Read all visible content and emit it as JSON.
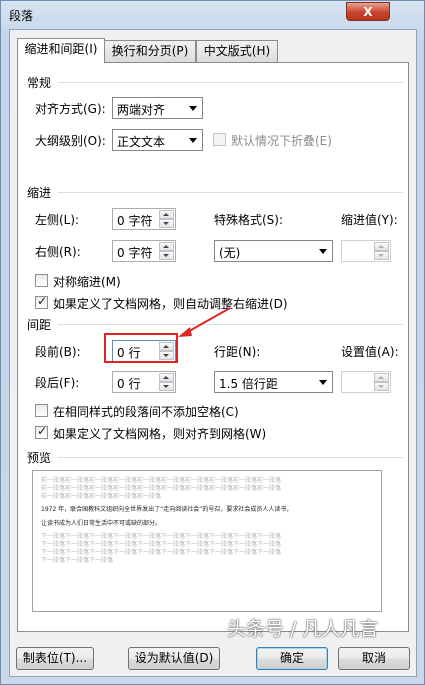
{
  "window": {
    "title": "段落",
    "close_glyph": "X"
  },
  "tabs": [
    {
      "label": "缩进和间距(I)",
      "active": true
    },
    {
      "label": "换行和分页(P)",
      "active": false
    },
    {
      "label": "中文版式(H)",
      "active": false
    }
  ],
  "general": {
    "heading": "常规",
    "alignment_label": "对齐方式(G):",
    "alignment_value": "两端对齐",
    "outline_label": "大纲级别(O):",
    "outline_value": "正文文本",
    "collapse_label": "默认情况下折叠(E)",
    "collapse_checked": false,
    "collapse_enabled": false
  },
  "indent": {
    "heading": "缩进",
    "left_label": "左侧(L):",
    "left_value": "0 字符",
    "right_label": "右侧(R):",
    "right_value": "0 字符",
    "special_label": "特殊格式(S):",
    "special_value": "(无)",
    "indent_by_label": "缩进值(Y):",
    "indent_by_value": "",
    "mirror_label": "对称缩进(M)",
    "mirror_checked": false,
    "auto_adjust_label": "如果定义了文档网格，则自动调整右缩进(D)",
    "auto_adjust_checked": true
  },
  "spacing": {
    "heading": "间距",
    "before_label": "段前(B):",
    "before_value": "0 行",
    "after_label": "段后(F):",
    "after_value": "0 行",
    "line_label": "行距(N):",
    "line_value": "1.5 倍行距",
    "at_label": "设置值(A):",
    "at_value": "",
    "no_space_label": "在相同样式的段落间不添加空格(C)",
    "no_space_checked": false,
    "snap_grid_label": "如果定义了文档网格，则对齐到网格(W)",
    "snap_grid_checked": true
  },
  "preview": {
    "heading": "预览",
    "prev_lines": [
      "前一段落前一段落前一段落前一段落前一段落前一段落前一段落前一段落前一段落前一段落",
      "前一段落前一段落前一段落前一段落前一段落前一段落前一段落前一段落前一段落前一段落",
      "前一段落前一段落前一段落前一段落前一段落"
    ],
    "sample_lines": [
      "1972 年，联合国教科文组织向全世界发出了“走向阅读社会”的号召，要求社会成员人人读书，",
      "让读书成为人们日常生活中不可或缺的部分。"
    ],
    "next_lines": [
      "下一段落下一段落下一段落下一段落下一段落下一段落下一段落下一段落下一段落下一段落",
      "下一段落下一段落下一段落下一段落下一段落下一段落下一段落下一段落下一段落下一段落",
      "下一段落下一段落下一段落下一段落下一段落下一段落下一段落下一段落下一段落下一段落",
      "下一段落下一段落下一段落"
    ]
  },
  "buttons": {
    "tabs": "制表位(T)...",
    "set_default": "设为默认值(D)",
    "ok": "确定",
    "cancel": "取消"
  },
  "watermark": "头条号 / 凡人凡言",
  "colors": {
    "annotation": "#e02424"
  }
}
